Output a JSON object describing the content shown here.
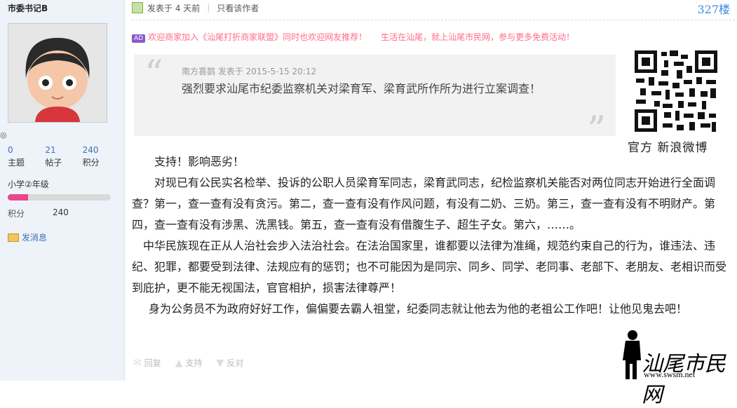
{
  "user": {
    "name": "市委书记B",
    "stats": [
      {
        "value": "0",
        "label": "主题"
      },
      {
        "value": "21",
        "label": "帖子"
      },
      {
        "value": "240",
        "label": "积分"
      }
    ],
    "level": "小学②年级",
    "level_progress": 0.2,
    "credit_label": "积分",
    "credit_value": "240",
    "message_label": "发消息"
  },
  "post": {
    "posted": "发表于 4 天前",
    "only_author": "只看该作者",
    "floor": "327楼",
    "ad_1": "欢迎商家加入《汕尾打折商家联盟》同时也欢迎网友推荐！",
    "ad_2": "生活在汕尾，就上汕尾市民网，参与更多免费活动！",
    "ad_badge": "AD",
    "quote_meta": "南方喜鹊 发表于 2015-5-15 20:12",
    "quote_text": "强烈要求汕尾市纪委监察机关对梁育军、梁育武所作所为进行立案调查！",
    "qr_caption": "官方  新浪微博",
    "paragraphs": [
      "支持！影响恶劣！",
      "对现已有公民实名检举、投诉的公职人员梁育军同志，梁育武同志，纪检监察机关能否对两位同志开始进行全面调查？第一，查一查有没有贪污。第二，查一查有没有作风问题，有没有二奶、三奶。第三，查一查有没有不明财产。第四，查一查有没有涉黑、洗黑钱。第五，查一查有没有借腹生子、超生子女。第六，……。",
      "中华民族现在正从人治社会步入法治社会。在法治国家里，谁都要以法律为准绳，规范约束自己的行为，谁违法、违纪、犯罪，都要受到法律、法规应有的惩罚；也不可能因为是同宗、同乡、同学、老同事、老部下、老朋友、老相识而受到庇护，更不能无视国法，官官相护，损害法律尊严！",
      "身为公务员不为政府好好工作，偏偏要去霸人祖堂，纪委同志就让他去为他的老祖公工作吧！让他见鬼去吧！"
    ],
    "actions": [
      "回复",
      "支持",
      "反对"
    ]
  },
  "watermark": {
    "text": "汕尾市民网",
    "url": "www.swsm.net"
  }
}
